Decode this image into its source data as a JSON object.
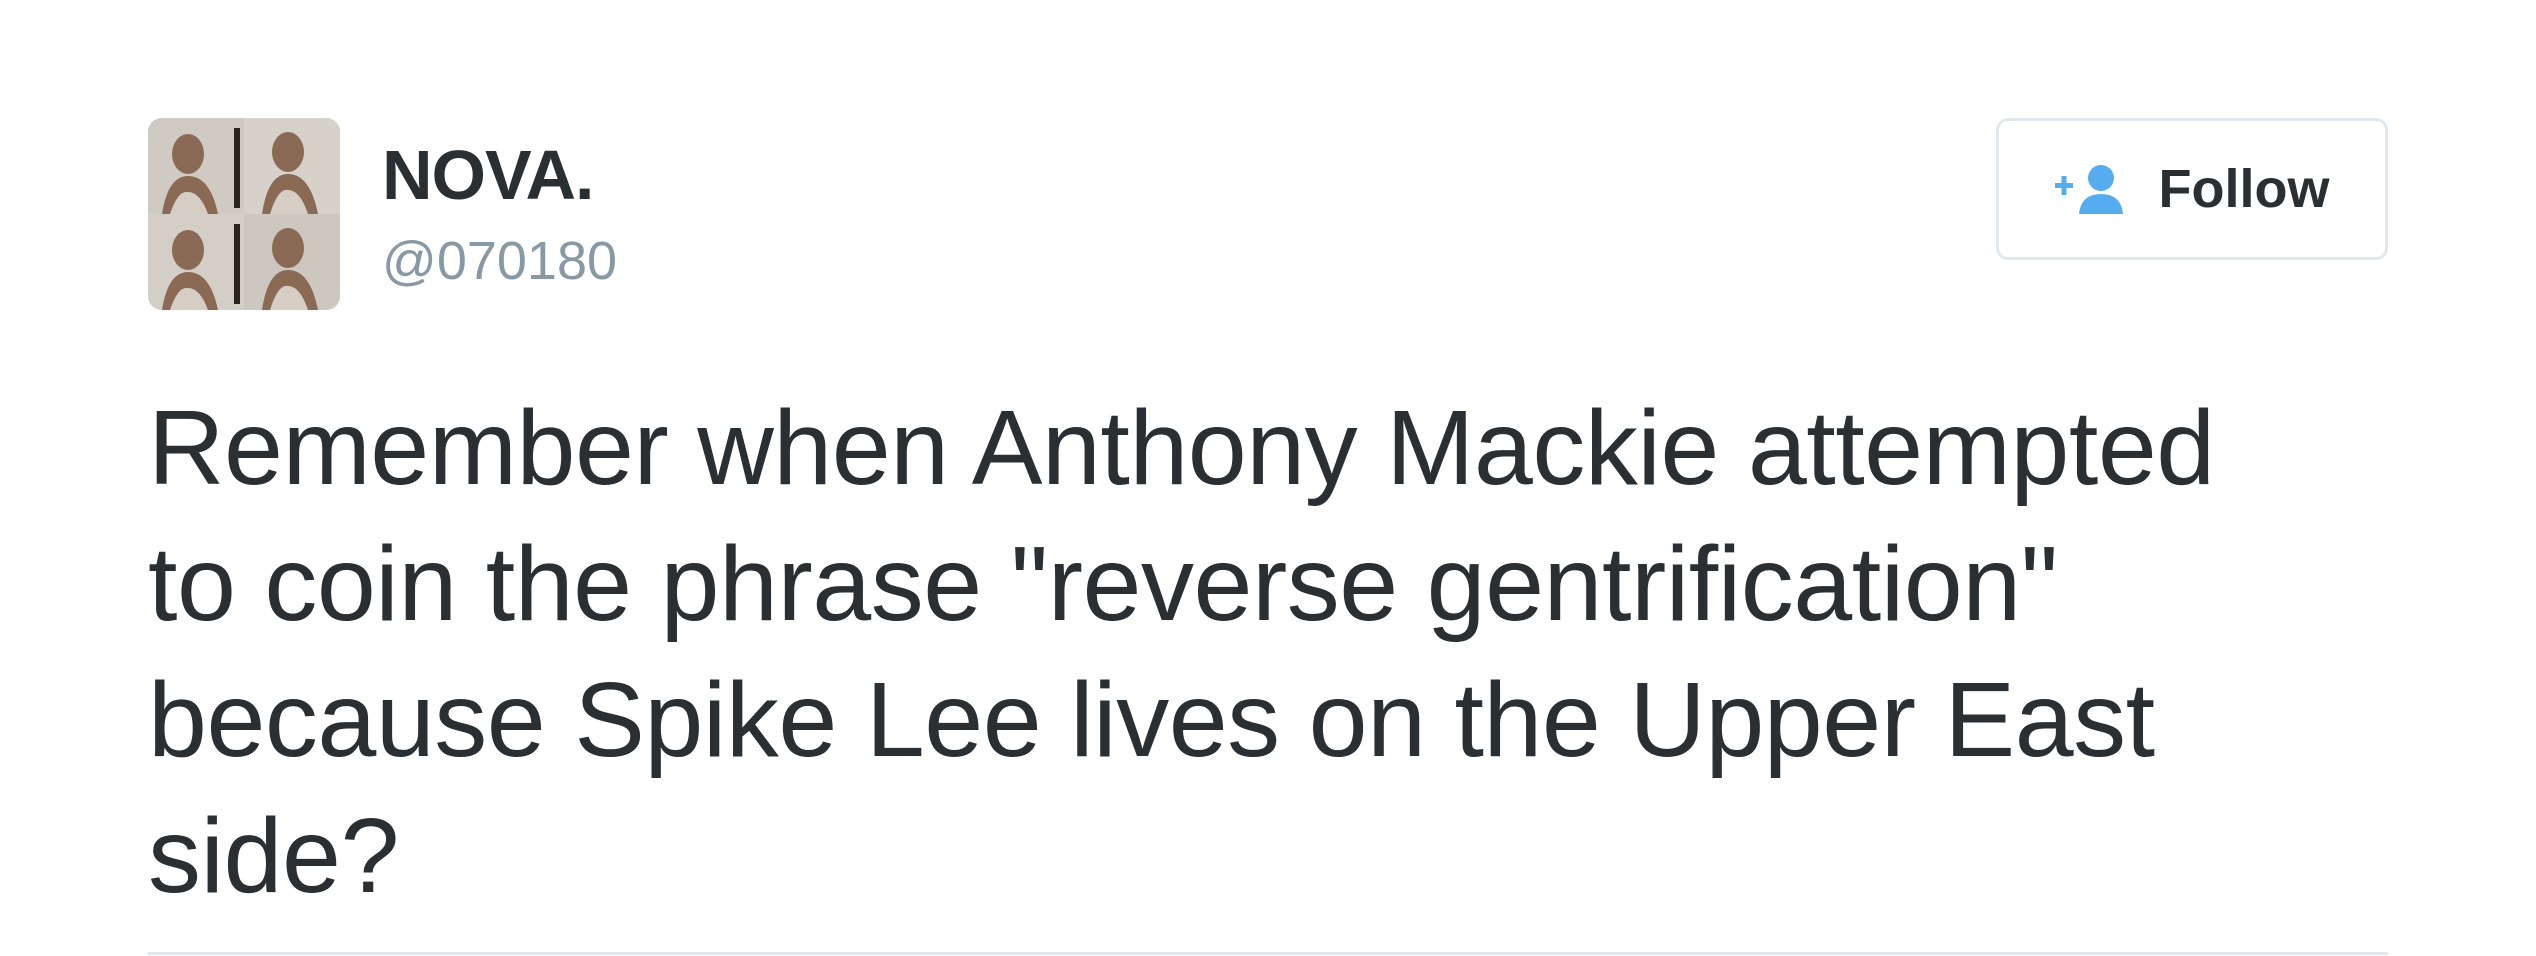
{
  "tweet": {
    "user": {
      "display_name": "NOVA.",
      "handle": "@070180",
      "avatar_icon": "profile-photo-grid"
    },
    "follow_button": {
      "label": "Follow",
      "icon": "add-user-icon",
      "accent_color": "#55acee"
    },
    "text": "Remember when Anthony Mackie attempted\nto coin the phrase \"reverse gentrification\"\nbecause Spike Lee lives on the Upper East\nside?"
  },
  "colors": {
    "text": "#292f33",
    "handle": "#8899a6",
    "border": "#e1e8ed",
    "accent": "#55acee"
  }
}
